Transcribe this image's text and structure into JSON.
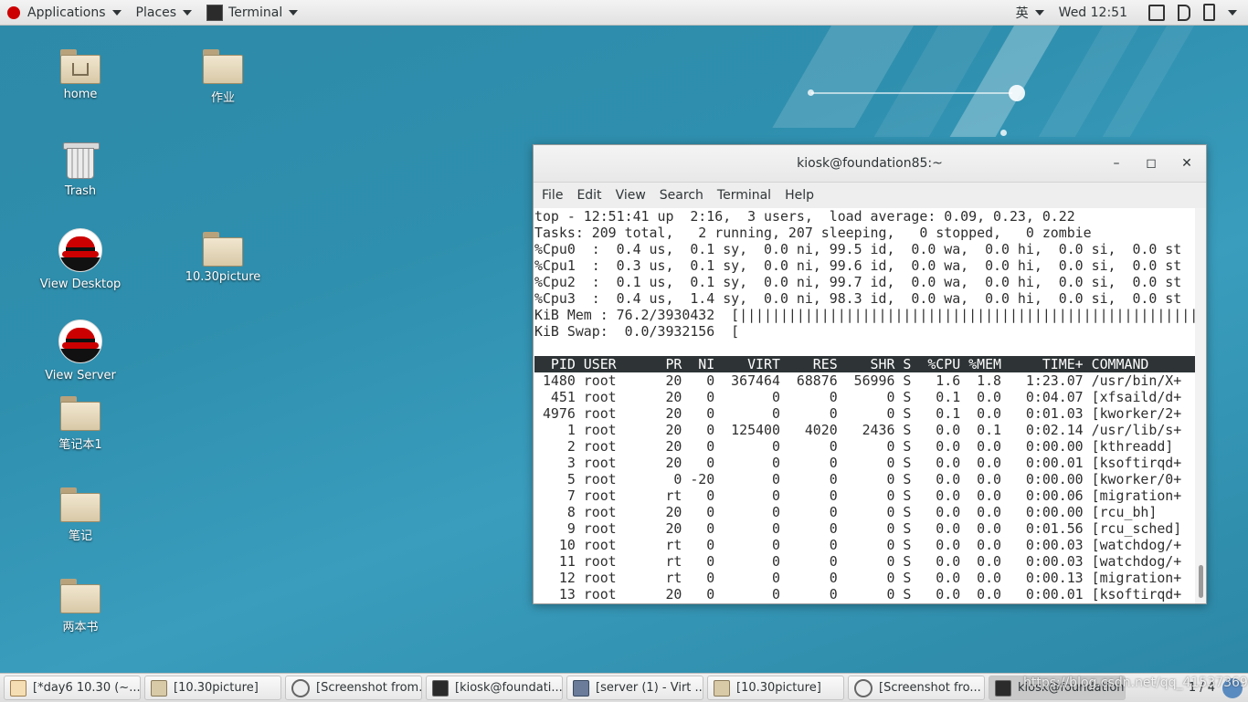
{
  "topbar": {
    "applications": "Applications",
    "places": "Places",
    "terminal": "Terminal",
    "input_method": "英",
    "clock": "Wed 12:51"
  },
  "desktop": {
    "icons": [
      {
        "label": "home"
      },
      {
        "label": "作业"
      },
      {
        "label": "Trash"
      },
      {
        "label": "View Desktop"
      },
      {
        "label": "10.30picture"
      },
      {
        "label": "View Server"
      },
      {
        "label": "笔记本1"
      },
      {
        "label": "笔记"
      },
      {
        "label": "两本书"
      }
    ]
  },
  "terminal": {
    "title": "kiosk@foundation85:~",
    "menu": [
      "File",
      "Edit",
      "View",
      "Search",
      "Terminal",
      "Help"
    ],
    "summary": [
      "top - 12:51:41 up  2:16,  3 users,  load average: 0.09, 0.23, 0.22",
      "Tasks: 209 total,   2 running, 207 sleeping,   0 stopped,   0 zombie",
      "%Cpu0  :  0.4 us,  0.1 sy,  0.0 ni, 99.5 id,  0.0 wa,  0.0 hi,  0.0 si,  0.0 st",
      "%Cpu1  :  0.3 us,  0.1 sy,  0.0 ni, 99.6 id,  0.0 wa,  0.0 hi,  0.0 si,  0.0 st",
      "%Cpu2  :  0.1 us,  0.1 sy,  0.0 ni, 99.7 id,  0.0 wa,  0.0 hi,  0.0 si,  0.0 st",
      "%Cpu3  :  0.4 us,  1.4 sy,  0.0 ni, 98.3 id,  0.0 wa,  0.0 hi,  0.0 si,  0.0 st",
      "KiB Mem : 76.2/3930432  [||||||||||||||||||||||||||||||||||||||||||||||||||||||||||||||||          ]",
      "KiB Swap:  0.0/3932156  [                                                                          ]",
      ""
    ],
    "header": "  PID USER      PR  NI    VIRT    RES    SHR S  %CPU %MEM     TIME+ COMMAND",
    "processes": [
      " 1480 root      20   0  367464  68876  56996 S   1.6  1.8   1:23.07 /usr/bin/X+",
      "  451 root      20   0       0      0      0 S   0.1  0.0   0:04.07 [xfsaild/d+",
      " 4976 root      20   0       0      0      0 S   0.1  0.0   0:01.03 [kworker/2+",
      "    1 root      20   0  125400   4020   2436 S   0.0  0.1   0:02.14 /usr/lib/s+",
      "    2 root      20   0       0      0      0 S   0.0  0.0   0:00.00 [kthreadd]",
      "    3 root      20   0       0      0      0 S   0.0  0.0   0:00.01 [ksoftirqd+",
      "    5 root       0 -20       0      0      0 S   0.0  0.0   0:00.00 [kworker/0+",
      "    7 root      rt   0       0      0      0 S   0.0  0.0   0:00.06 [migration+",
      "    8 root      20   0       0      0      0 S   0.0  0.0   0:00.00 [rcu_bh]",
      "    9 root      20   0       0      0      0 S   0.0  0.0   0:01.56 [rcu_sched]",
      "   10 root      rt   0       0      0      0 S   0.0  0.0   0:00.03 [watchdog/+",
      "   11 root      rt   0       0      0      0 S   0.0  0.0   0:00.03 [watchdog/+",
      "   12 root      rt   0       0      0      0 S   0.0  0.0   0:00.13 [migration+",
      "   13 root      20   0       0      0      0 S   0.0  0.0   0:00.01 [ksoftirqd+"
    ]
  },
  "taskbar": {
    "tasks": [
      {
        "label": "[*day6 10.30 (~...",
        "icon": "text-editor-icon"
      },
      {
        "label": "[10.30picture]",
        "icon": "folder-icon"
      },
      {
        "label": "[Screenshot from...",
        "icon": "screenshot-icon"
      },
      {
        "label": "[kiosk@foundati...",
        "icon": "terminal-icon"
      },
      {
        "label": "[server (1) - Virt ...",
        "icon": "virt-manager-icon"
      },
      {
        "label": "[10.30picture]",
        "icon": "folder-icon"
      },
      {
        "label": "[Screenshot fro...",
        "icon": "screenshot-icon"
      },
      {
        "label": "kiosk@foundation...",
        "icon": "terminal-icon"
      }
    ],
    "workspace": "1 / 4"
  },
  "watermark": "https://blog.csdn.net/qq_41537369"
}
